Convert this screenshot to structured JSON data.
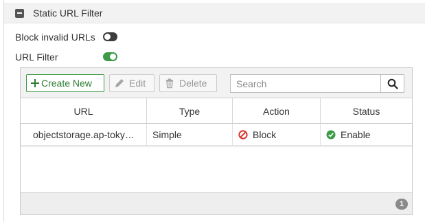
{
  "section": {
    "title": "Static URL Filter"
  },
  "settings": [
    {
      "label": "Block invalid URLs",
      "enabled": false
    },
    {
      "label": "URL Filter",
      "enabled": true
    }
  ],
  "toolbar": {
    "create_label": "Create New",
    "edit_label": "Edit",
    "delete_label": "Delete"
  },
  "search": {
    "placeholder": "Search",
    "value": ""
  },
  "table": {
    "columns": [
      "URL",
      "Type",
      "Action",
      "Status"
    ],
    "rows": [
      {
        "url": "objectstorage.ap-toky…",
        "type": "Simple",
        "action": "Block",
        "status": "Enable"
      }
    ]
  },
  "footer": {
    "count": "1"
  },
  "colors": {
    "enabled_toggle": "#3d9a46",
    "block_icon": "#d9342b",
    "enable_icon": "#3d9a46"
  },
  "icons": {
    "collapse": "minus-square-icon",
    "create": "plus-icon",
    "edit": "pencil-icon",
    "delete": "trash-icon",
    "search": "magnifier-icon",
    "block": "no-entry-icon",
    "enable": "check-circle-icon"
  }
}
